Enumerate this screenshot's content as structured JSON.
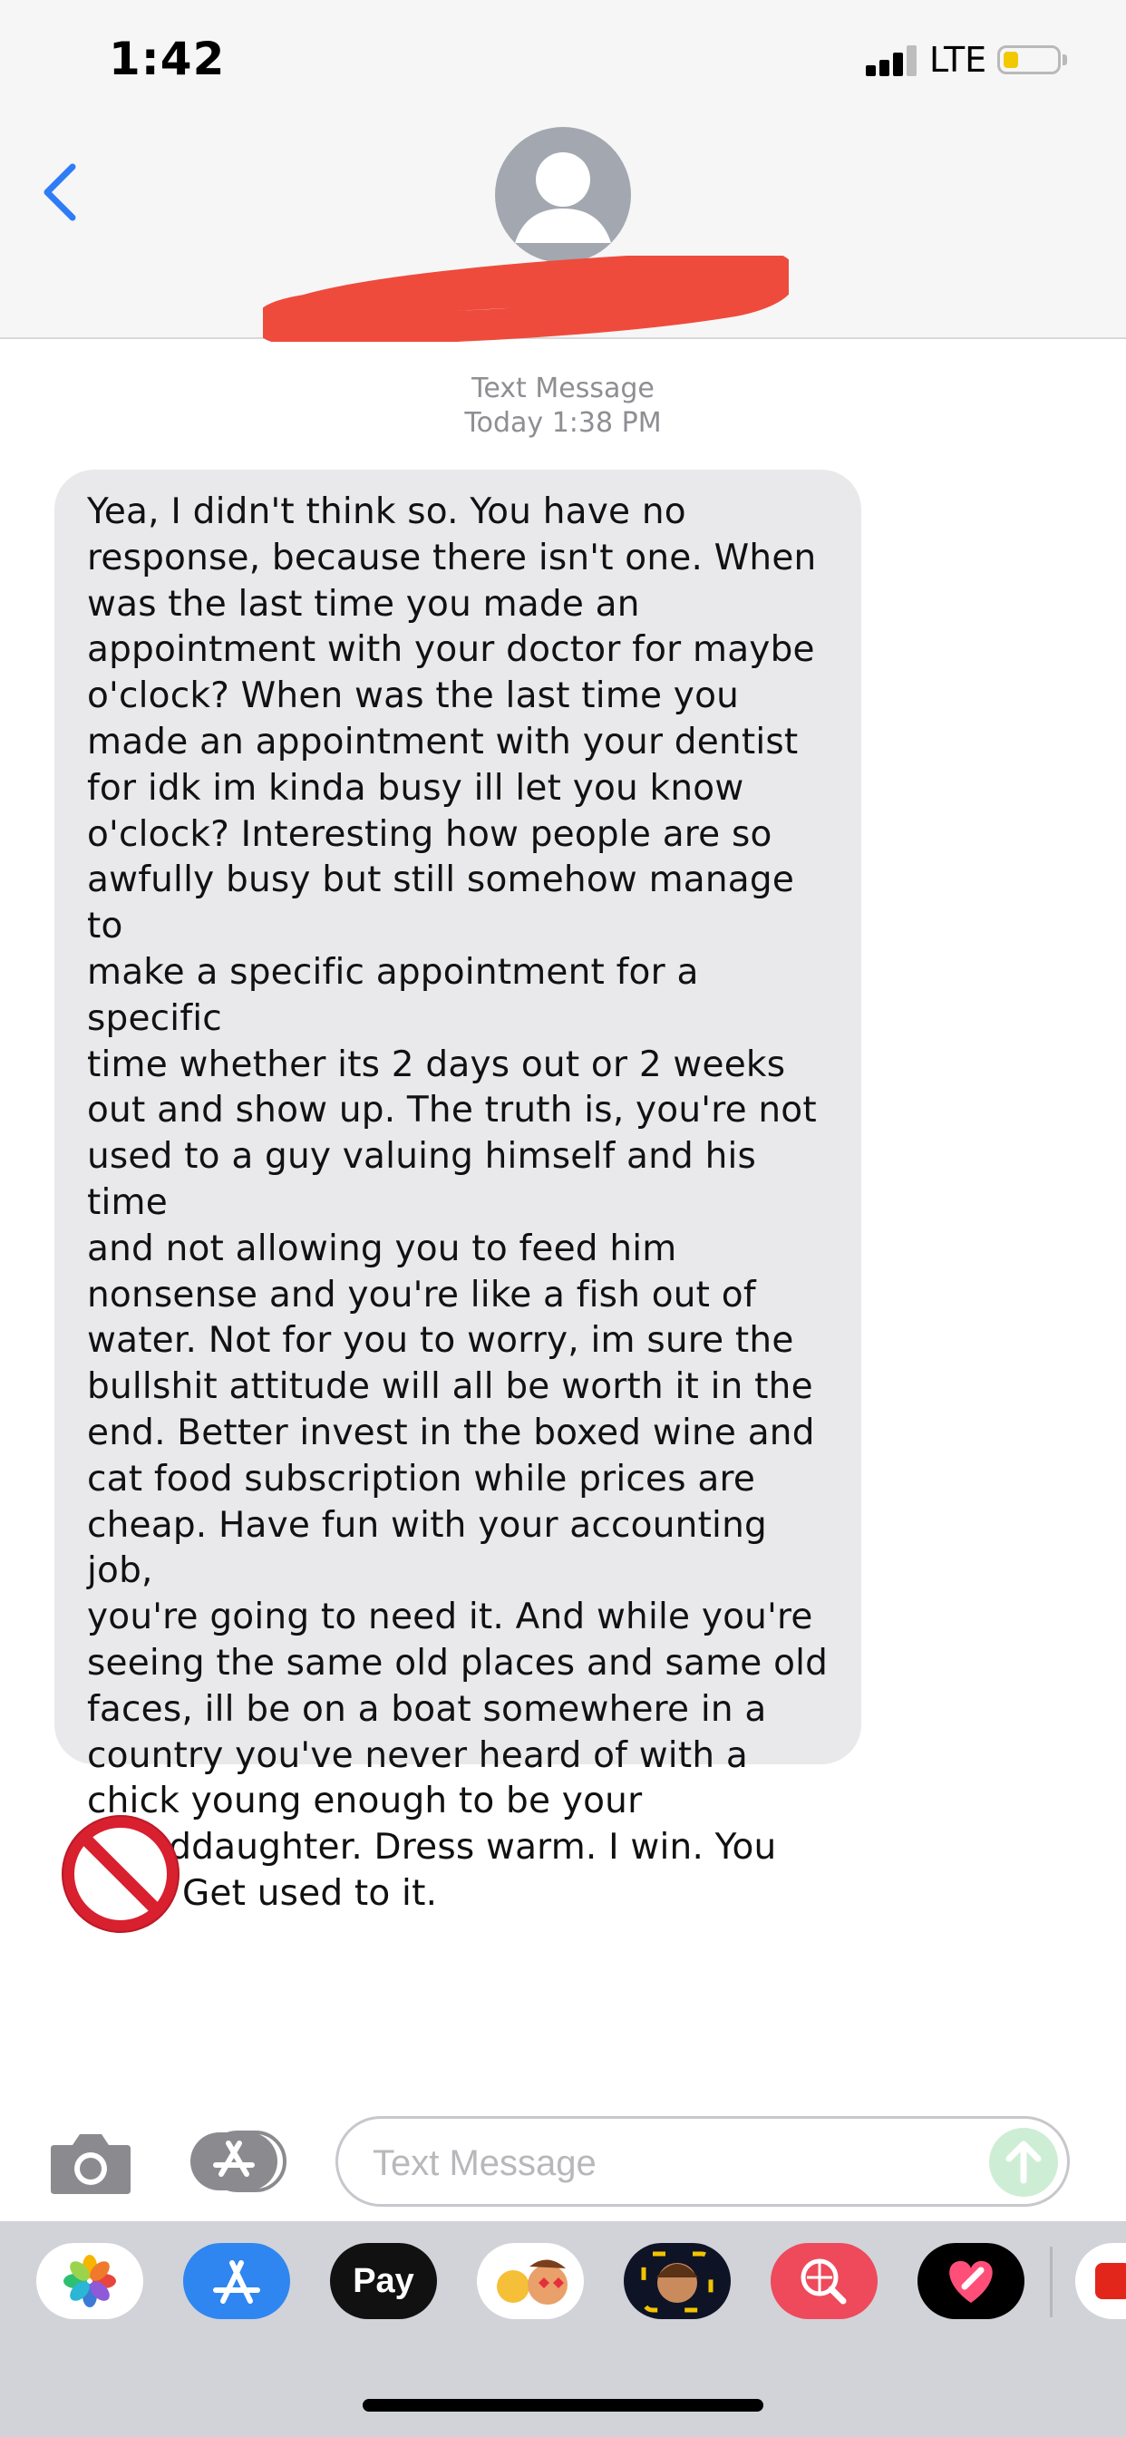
{
  "status_bar": {
    "time": "1:42",
    "network": "LTE",
    "battery_level": 0.2,
    "battery_color": "#f2c900"
  },
  "header": {
    "back_icon": "chevron-left-icon",
    "accent_color": "#2f7cf6",
    "avatar_icon": "person-silhouette-icon",
    "contact_name_redacted": true,
    "redaction_color": "#ee4b3c"
  },
  "thread": {
    "service_label": "Text Message",
    "timestamp": "Today 1:38 PM",
    "messages": [
      {
        "direction": "incoming",
        "bubble_color": "#e9e9eb",
        "lines": [
          "Yea, I didn't think so. You have no",
          "response, because there isn't one. When",
          "was the last time you made an",
          "appointment with your doctor for maybe",
          "o'clock? When was the last time you",
          "made an appointment with your dentist",
          "for idk im kinda busy ill let you know",
          "o'clock? Interesting how people are so",
          "awfully busy but still somehow manage to",
          "make a specific appointment for a specific",
          "time whether its 2 days out or 2 weeks",
          "out and show up. The truth is, you're not",
          "used to a guy valuing himself and his time",
          "and not allowing you to feed him",
          "nonsense and you're like a fish out of",
          "water. Not for you to worry, im sure the",
          "bullshit attitude will all be worth it in the",
          "end. Better invest in the boxed wine and",
          "cat food subscription while prices are",
          "cheap. Have fun with your accounting job,",
          "you're going to need it. And while you're",
          "seeing the same old places and same old",
          "faces, ill be on a boat somewhere in a",
          "country you've never heard of with a",
          "chick young enough to be your",
          "granddaughter. Dress warm. I win. You",
          "lose. Get used to it."
        ]
      },
      {
        "direction": "incoming",
        "emoji": "🚫",
        "emoji_name": "prohibited-icon"
      }
    ]
  },
  "compose": {
    "camera_icon": "camera-icon",
    "apps_icon": "app-store-icon",
    "placeholder": "Text Message",
    "value": "",
    "send_icon": "arrow-up-icon",
    "send_color": "#cdeed5"
  },
  "app_drawer": {
    "apps": [
      {
        "name": "photos-app-icon"
      },
      {
        "name": "app-store-app-icon"
      },
      {
        "name": "apple-pay-app-icon",
        "label": "Pay"
      },
      {
        "name": "animoji-app-icon"
      },
      {
        "name": "memoji-app-icon"
      },
      {
        "name": "image-search-app-icon"
      },
      {
        "name": "digital-touch-app-icon"
      },
      {
        "name": "partial-app-icon"
      }
    ]
  }
}
